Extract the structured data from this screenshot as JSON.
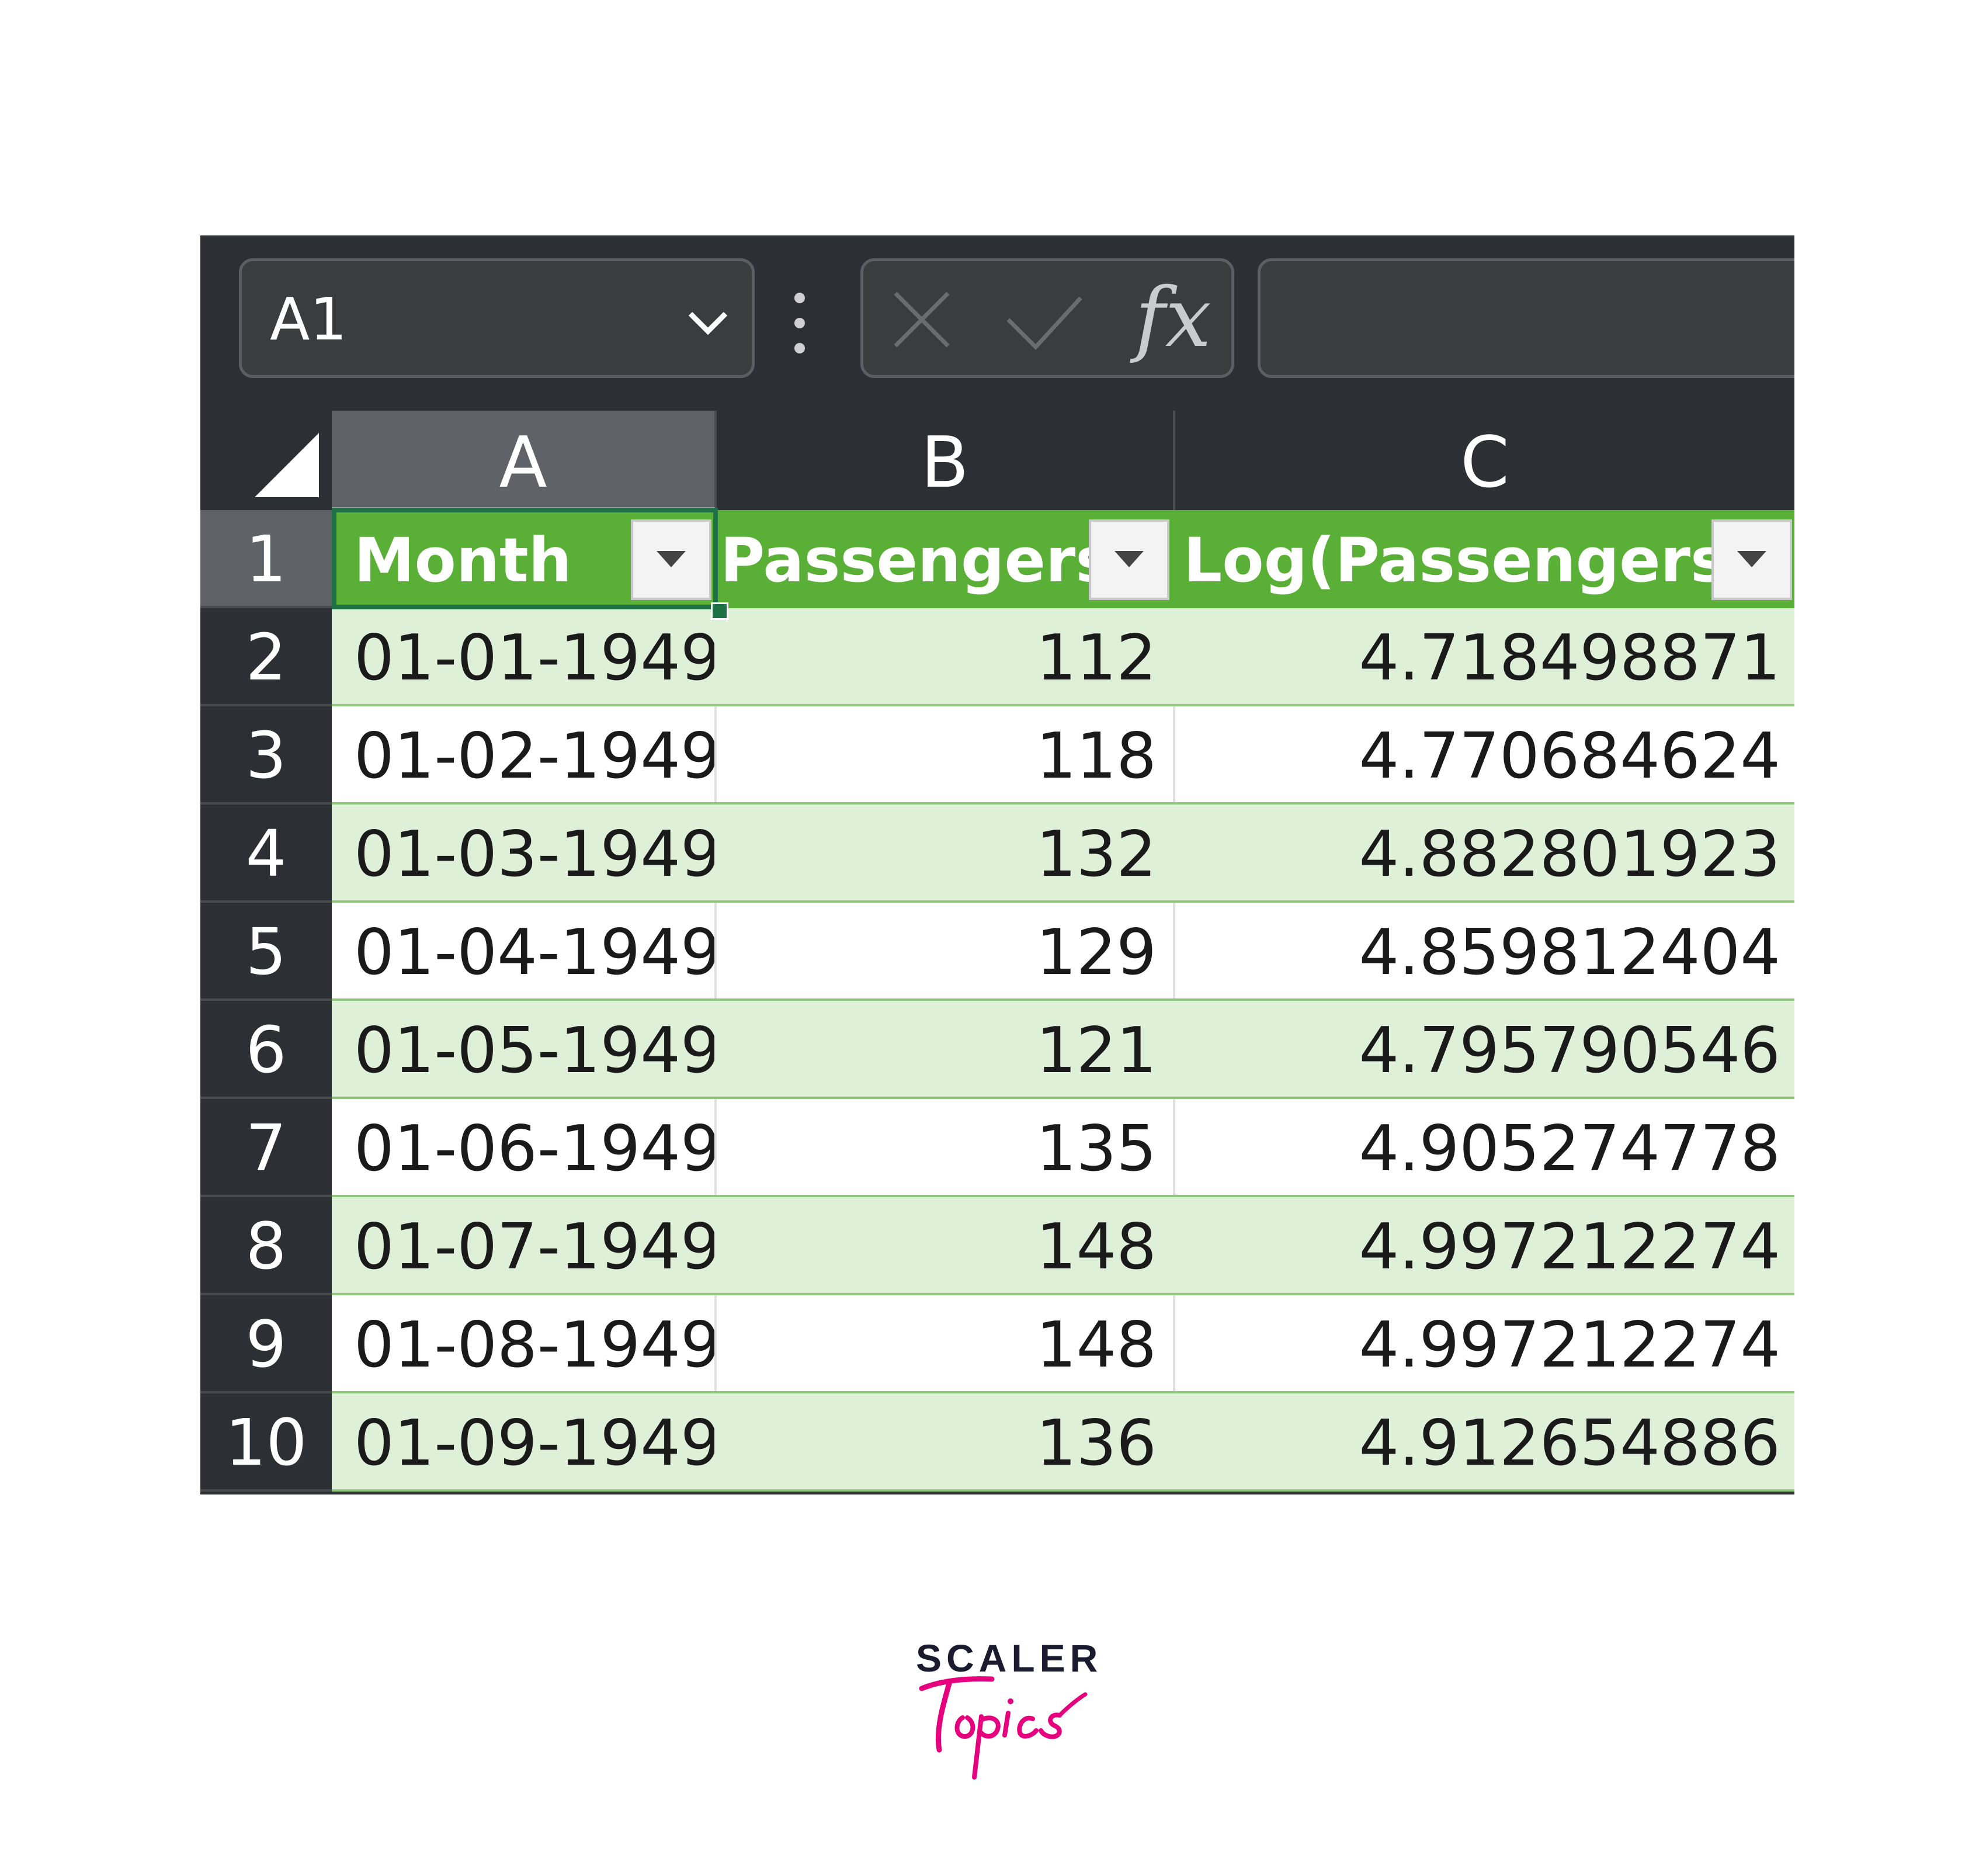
{
  "formula_bar": {
    "name_box": "A1",
    "formula_value": ""
  },
  "columns": [
    "A",
    "B",
    "C"
  ],
  "active_cell": "A1",
  "rows": [
    "1",
    "2",
    "3",
    "4",
    "5",
    "6",
    "7",
    "8",
    "9",
    "10"
  ],
  "table": {
    "headers": [
      "Month",
      "Passengers",
      "Log(Passengers)"
    ],
    "data": [
      [
        "01-01-1949",
        "112",
        "4.718498871"
      ],
      [
        "01-02-1949",
        "118",
        "4.770684624"
      ],
      [
        "01-03-1949",
        "132",
        "4.882801923"
      ],
      [
        "01-04-1949",
        "129",
        "4.859812404"
      ],
      [
        "01-05-1949",
        "121",
        "4.795790546"
      ],
      [
        "01-06-1949",
        "135",
        "4.905274778"
      ],
      [
        "01-07-1949",
        "148",
        "4.997212274"
      ],
      [
        "01-08-1949",
        "148",
        "4.997212274"
      ],
      [
        "01-09-1949",
        "136",
        "4.912654886"
      ]
    ]
  },
  "colors": {
    "header_green": "#5aaf36",
    "band_green": "#dff0d8",
    "selection": "#1e7145",
    "logo_pink": "#e6007e"
  },
  "logo": {
    "top": "SCALER",
    "script": "Topics"
  }
}
